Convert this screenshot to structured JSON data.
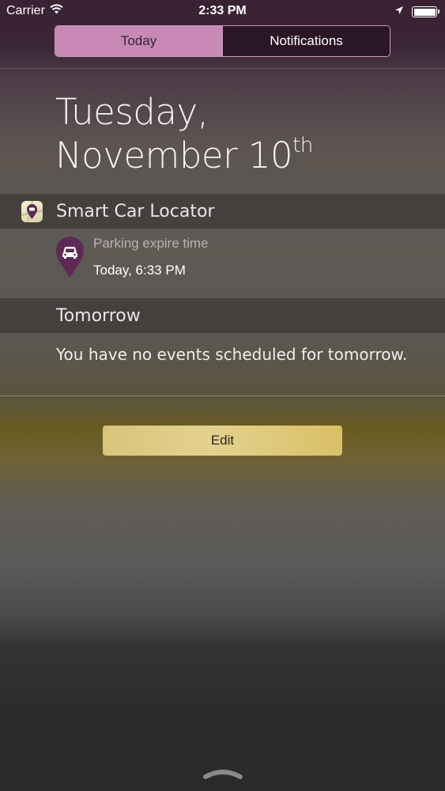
{
  "status_bar": {
    "carrier": "Carrier",
    "time": "2:33 PM",
    "battery_level": 1.0
  },
  "tabs": [
    {
      "label": "Today",
      "active": true
    },
    {
      "label": "Notifications",
      "active": false
    }
  ],
  "date": {
    "weekday": "Tuesday,",
    "month_day": "November 10",
    "ordinal_suffix": "th"
  },
  "widgets": {
    "smart_car_locator": {
      "title": "Smart Car Locator",
      "icon": "car-pin-icon",
      "parking_label": "Parking expire time",
      "parking_value": "Today, 6:33 PM"
    },
    "tomorrow": {
      "title": "Tomorrow",
      "message": "You have no events scheduled for tomorrow."
    }
  },
  "edit_button": {
    "label": "Edit"
  },
  "colors": {
    "accent_purple": "#c889b6",
    "pin_purple": "#5e2a55",
    "edit_gold": "#e0cc86"
  }
}
